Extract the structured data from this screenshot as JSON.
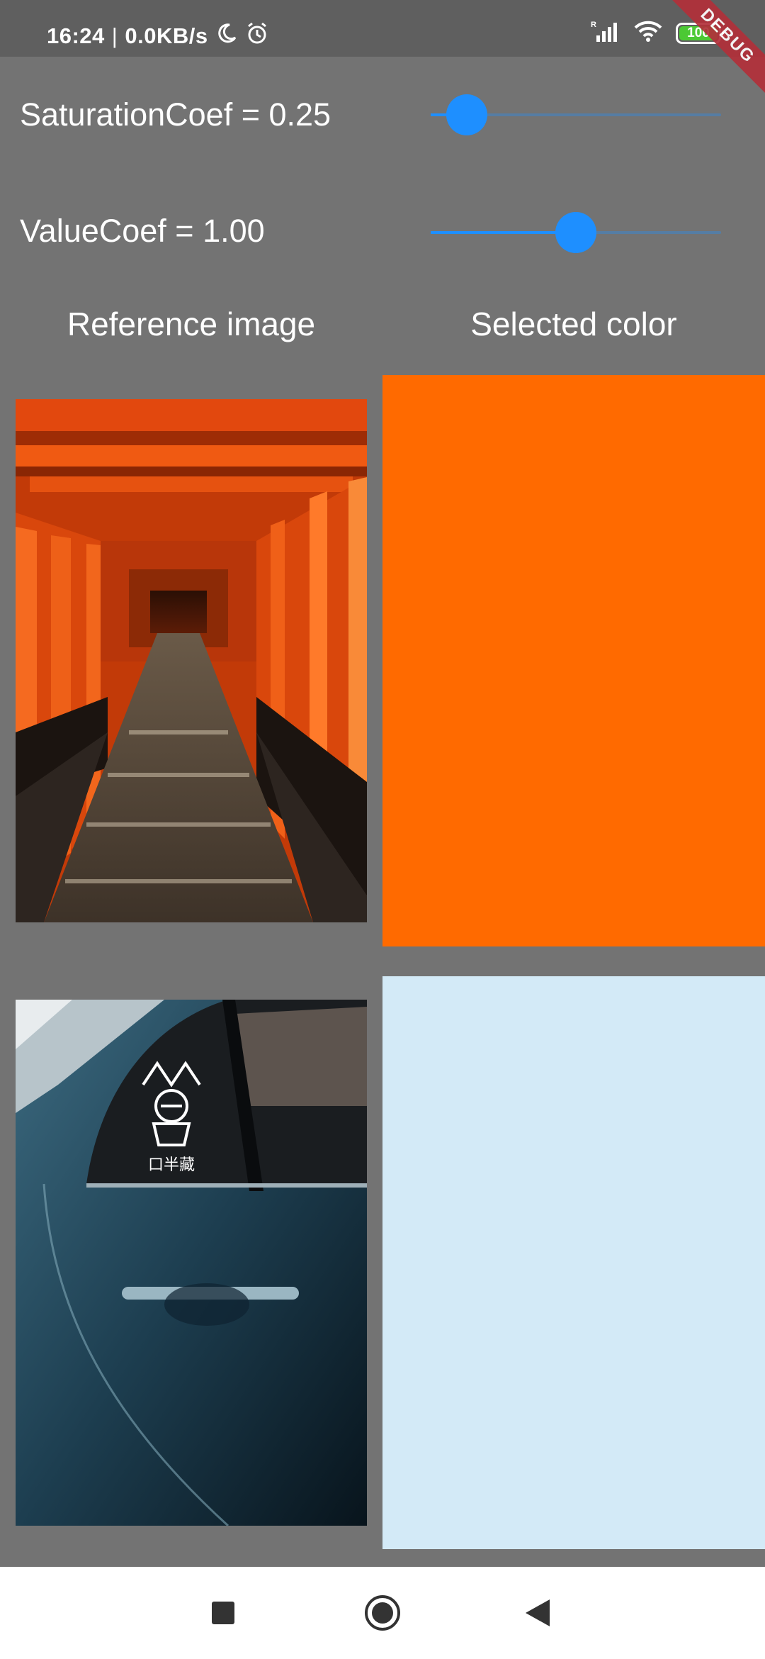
{
  "status_bar": {
    "time": "16:24",
    "network_speed": "0.0KB/s",
    "battery_level": "100",
    "icons": [
      "moon-icon",
      "alarm-icon",
      "signal-icon",
      "wifi-icon",
      "battery-icon"
    ]
  },
  "debug_banner": "DEBUG",
  "sliders": {
    "saturation": {
      "label": "SaturationCoef = 0.25",
      "value": 0.25,
      "min": 0,
      "max": 2
    },
    "value": {
      "label": "ValueCoef = 1.00",
      "value": 1.0,
      "min": 0,
      "max": 2
    }
  },
  "headers": {
    "reference": "Reference image",
    "selected": "Selected color"
  },
  "rows": [
    {
      "image": "torii-gates-tunnel",
      "selected_color": "#ff6a00"
    },
    {
      "image": "blue-car-door",
      "selected_color": "#d3eaf7"
    }
  ],
  "colors": {
    "accent": "#1e8fff",
    "background": "#737373",
    "status_bar": "#5f5f5f",
    "debug": "#b2303a"
  },
  "nav_bar": {
    "buttons": [
      "recents-square-icon",
      "home-circle-icon",
      "back-triangle-icon"
    ]
  }
}
